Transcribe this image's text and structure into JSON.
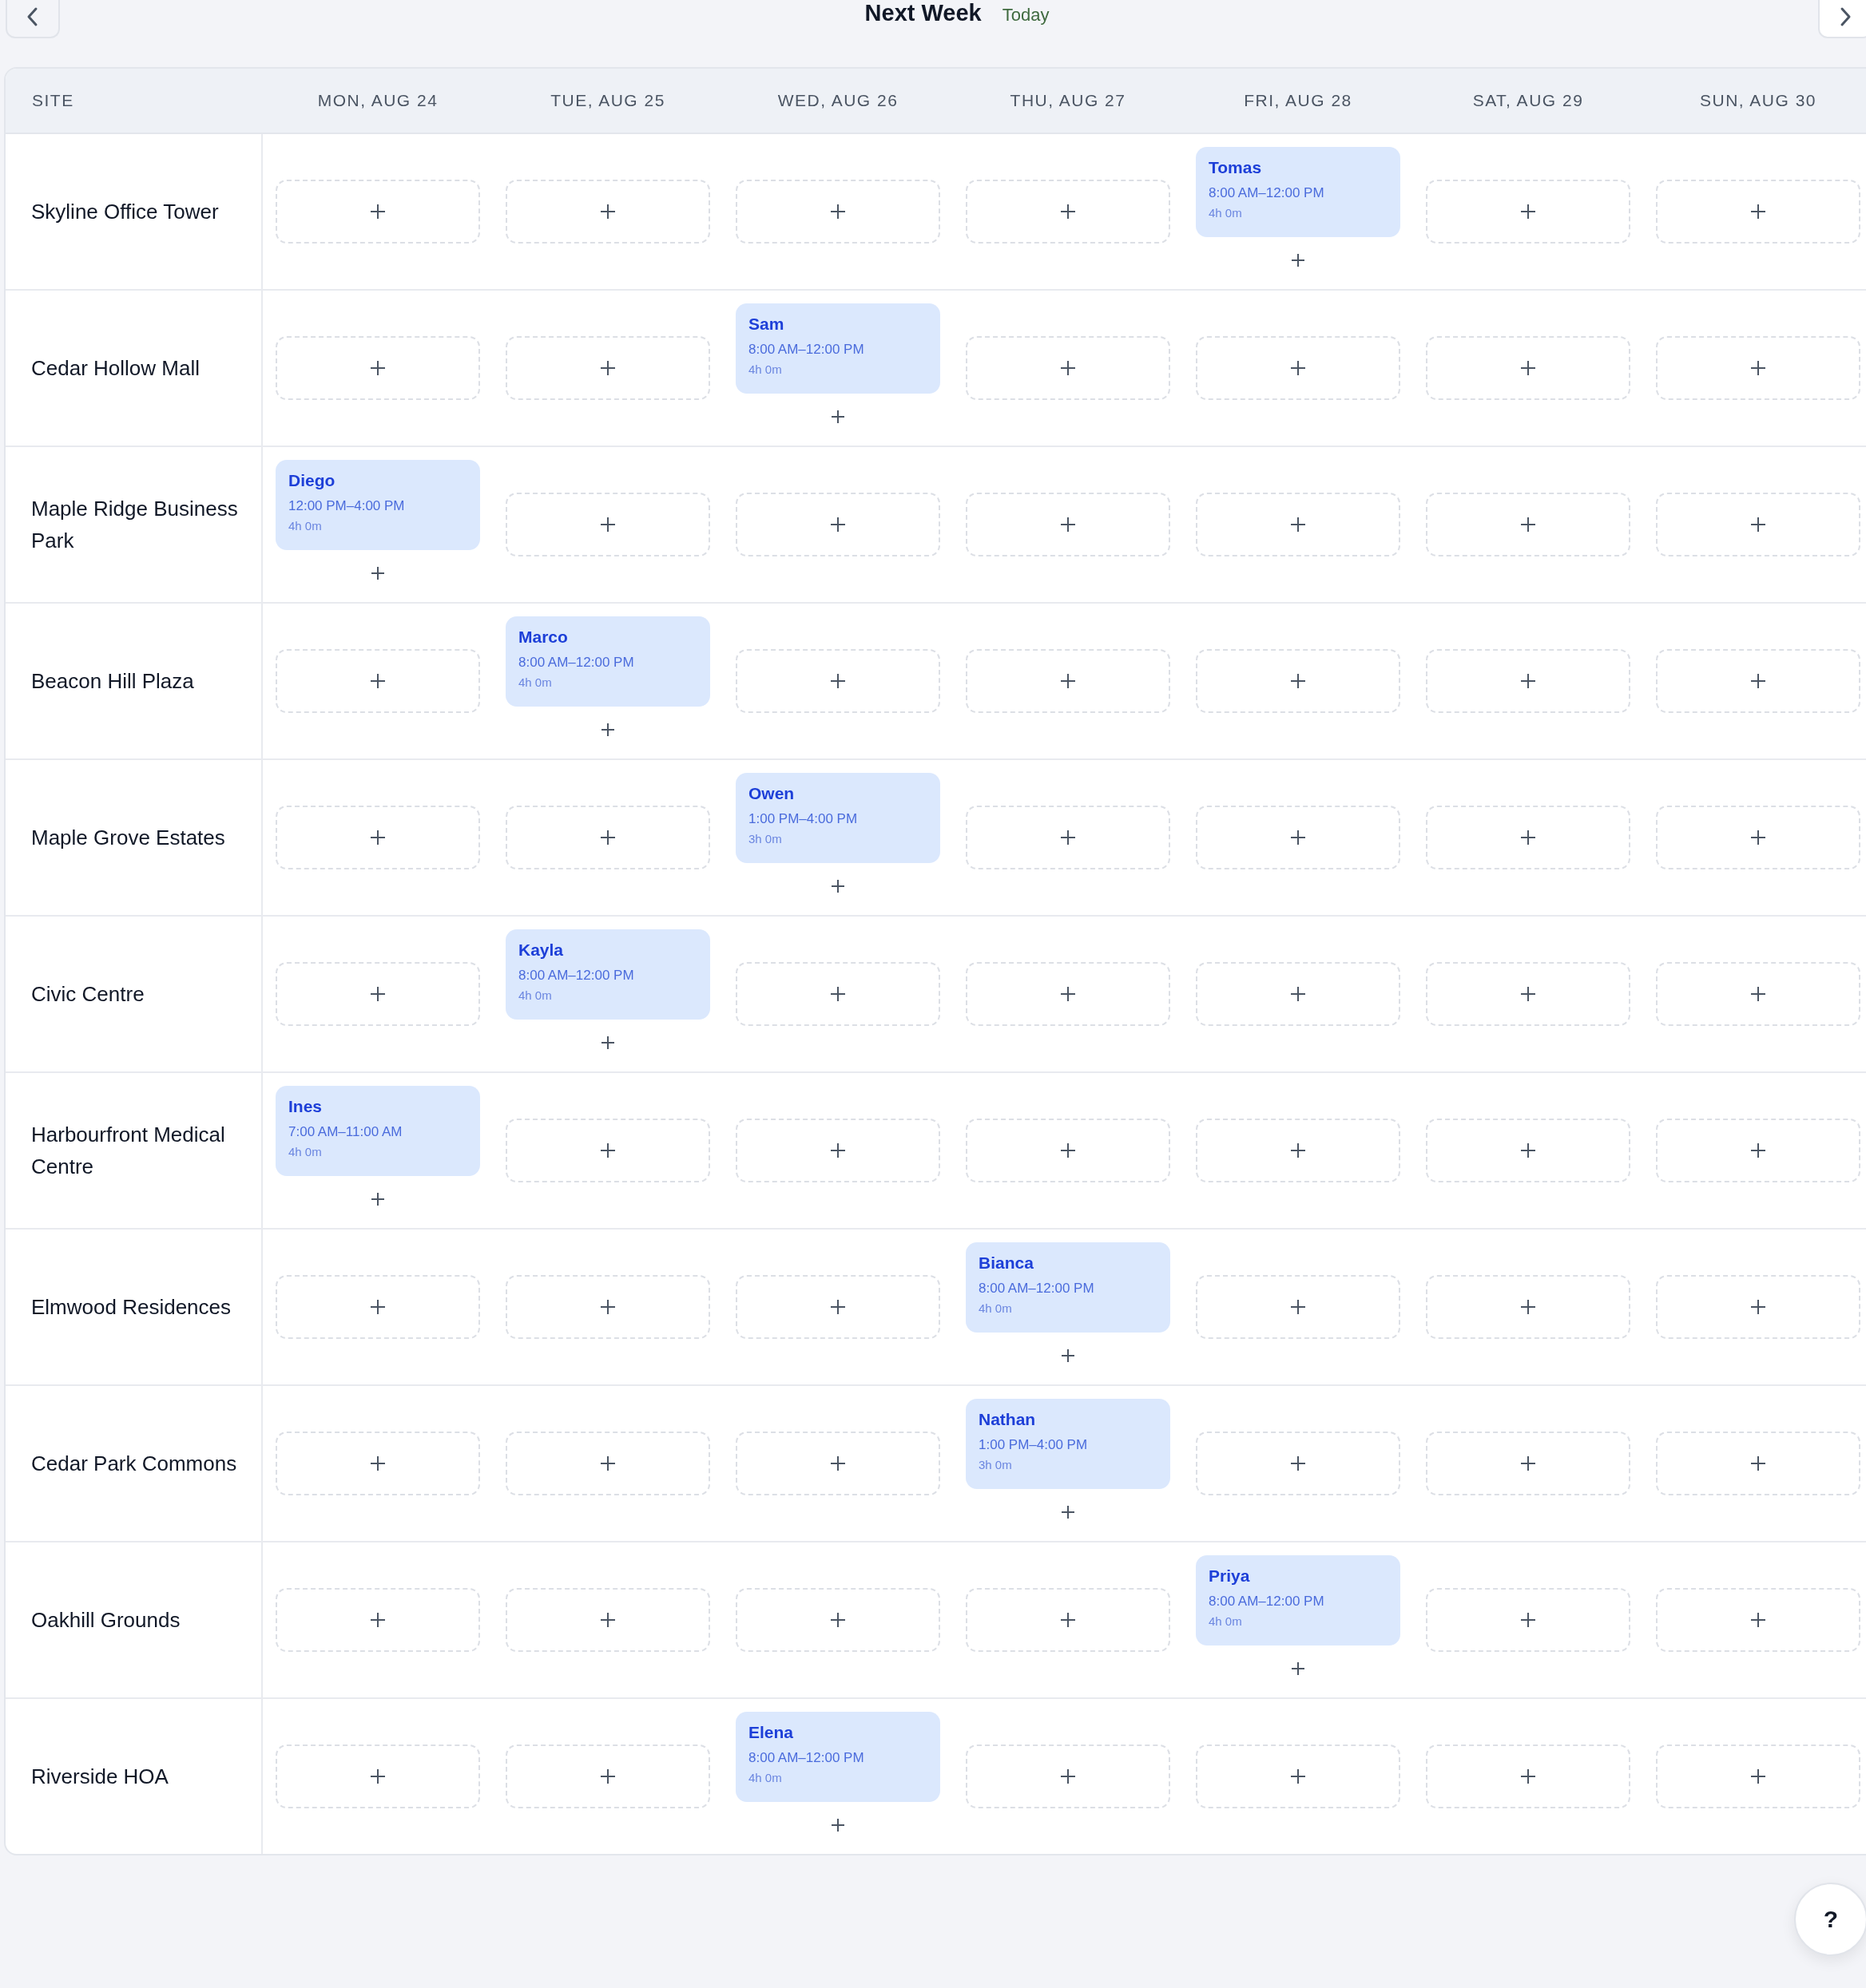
{
  "toolbar": {
    "title": "Next Week",
    "today": "Today"
  },
  "table": {
    "site_header": "SITE",
    "days": [
      "MON, AUG 24",
      "TUE, AUG 25",
      "WED, AUG 26",
      "THU, AUG 27",
      "FRI, AUG 28",
      "SAT, AUG 29",
      "SUN, AUG 30"
    ],
    "rows": [
      {
        "site": "Skyline Office Tower",
        "cells": [
          {
            "kind": "empty"
          },
          {
            "kind": "empty"
          },
          {
            "kind": "empty"
          },
          {
            "kind": "empty"
          },
          {
            "kind": "shift",
            "name": "Tomas",
            "time": "8:00 AM–12:00 PM",
            "duration": "4h 0m"
          },
          {
            "kind": "empty"
          },
          {
            "kind": "empty"
          }
        ]
      },
      {
        "site": "Cedar Hollow Mall",
        "cells": [
          {
            "kind": "empty"
          },
          {
            "kind": "empty"
          },
          {
            "kind": "shift",
            "name": "Sam",
            "time": "8:00 AM–12:00 PM",
            "duration": "4h 0m"
          },
          {
            "kind": "empty"
          },
          {
            "kind": "empty"
          },
          {
            "kind": "empty"
          },
          {
            "kind": "empty"
          }
        ]
      },
      {
        "site": "Maple Ridge Business Park",
        "cells": [
          {
            "kind": "shift",
            "name": "Diego",
            "time": "12:00 PM–4:00 PM",
            "duration": "4h 0m"
          },
          {
            "kind": "empty"
          },
          {
            "kind": "empty"
          },
          {
            "kind": "empty"
          },
          {
            "kind": "empty"
          },
          {
            "kind": "empty"
          },
          {
            "kind": "empty"
          }
        ]
      },
      {
        "site": "Beacon Hill Plaza",
        "cells": [
          {
            "kind": "empty"
          },
          {
            "kind": "shift",
            "name": "Marco",
            "time": "8:00 AM–12:00 PM",
            "duration": "4h 0m"
          },
          {
            "kind": "empty"
          },
          {
            "kind": "empty"
          },
          {
            "kind": "empty"
          },
          {
            "kind": "empty"
          },
          {
            "kind": "empty"
          }
        ]
      },
      {
        "site": "Maple Grove Estates",
        "cells": [
          {
            "kind": "empty"
          },
          {
            "kind": "empty"
          },
          {
            "kind": "shift",
            "name": "Owen",
            "time": "1:00 PM–4:00 PM",
            "duration": "3h 0m"
          },
          {
            "kind": "empty"
          },
          {
            "kind": "empty"
          },
          {
            "kind": "empty"
          },
          {
            "kind": "empty"
          }
        ]
      },
      {
        "site": "Civic Centre",
        "cells": [
          {
            "kind": "empty"
          },
          {
            "kind": "shift",
            "name": "Kayla",
            "time": "8:00 AM–12:00 PM",
            "duration": "4h 0m"
          },
          {
            "kind": "empty"
          },
          {
            "kind": "empty"
          },
          {
            "kind": "empty"
          },
          {
            "kind": "empty"
          },
          {
            "kind": "empty"
          }
        ]
      },
      {
        "site": "Harbourfront Medical Centre",
        "cells": [
          {
            "kind": "shift",
            "name": "Ines",
            "time": "7:00 AM–11:00 AM",
            "duration": "4h 0m"
          },
          {
            "kind": "empty"
          },
          {
            "kind": "empty"
          },
          {
            "kind": "empty"
          },
          {
            "kind": "empty"
          },
          {
            "kind": "empty"
          },
          {
            "kind": "empty"
          }
        ]
      },
      {
        "site": "Elmwood Residences",
        "cells": [
          {
            "kind": "empty"
          },
          {
            "kind": "empty"
          },
          {
            "kind": "empty"
          },
          {
            "kind": "shift",
            "name": "Bianca",
            "time": "8:00 AM–12:00 PM",
            "duration": "4h 0m"
          },
          {
            "kind": "empty"
          },
          {
            "kind": "empty"
          },
          {
            "kind": "empty"
          }
        ]
      },
      {
        "site": "Cedar Park Commons",
        "cells": [
          {
            "kind": "empty"
          },
          {
            "kind": "empty"
          },
          {
            "kind": "empty"
          },
          {
            "kind": "shift",
            "name": "Nathan",
            "time": "1:00 PM–4:00 PM",
            "duration": "3h 0m"
          },
          {
            "kind": "empty"
          },
          {
            "kind": "empty"
          },
          {
            "kind": "empty"
          }
        ]
      },
      {
        "site": "Oakhill Grounds",
        "cells": [
          {
            "kind": "empty"
          },
          {
            "kind": "empty"
          },
          {
            "kind": "empty"
          },
          {
            "kind": "empty"
          },
          {
            "kind": "shift",
            "name": "Priya",
            "time": "8:00 AM–12:00 PM",
            "duration": "4h 0m"
          },
          {
            "kind": "empty"
          },
          {
            "kind": "empty"
          }
        ]
      },
      {
        "site": "Riverside HOA",
        "cells": [
          {
            "kind": "empty"
          },
          {
            "kind": "empty"
          },
          {
            "kind": "shift",
            "name": "Elena",
            "time": "8:00 AM–12:00 PM",
            "duration": "4h 0m"
          },
          {
            "kind": "empty"
          },
          {
            "kind": "empty"
          },
          {
            "kind": "empty"
          },
          {
            "kind": "empty"
          }
        ]
      }
    ]
  },
  "help": {
    "label": "?"
  }
}
